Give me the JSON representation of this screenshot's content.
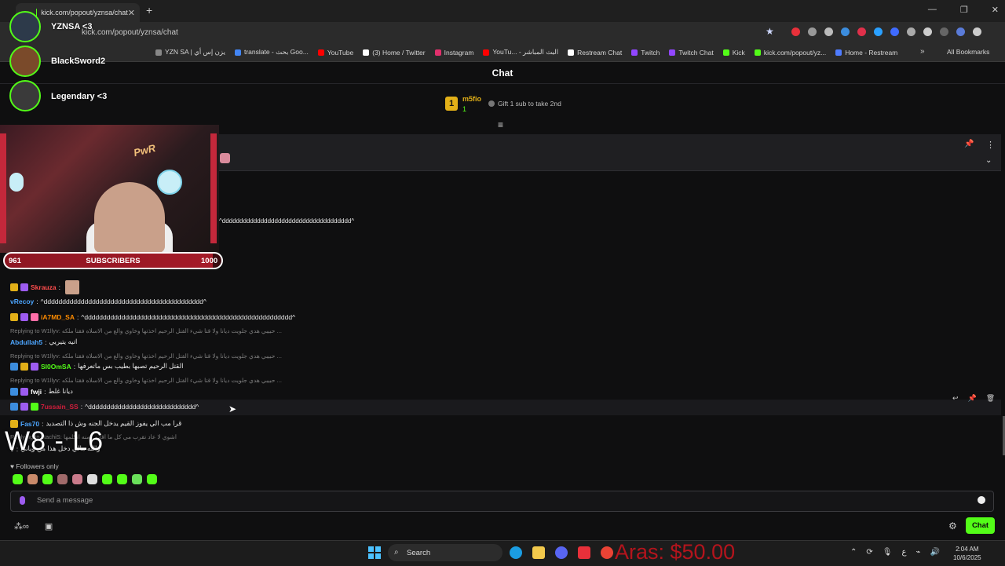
{
  "browser": {
    "tab_title": "kick.com/popout/yznsa/chat",
    "url": "kick.com/popout/yznsa/chat",
    "bookmarks": [
      {
        "label": "YZN SA | يزن إس أي",
        "color": "#888888"
      },
      {
        "label": "translate - بحث Goo...",
        "color": "#4285f4"
      },
      {
        "label": "YouTube",
        "color": "#ff0000"
      },
      {
        "label": "(3) Home / Twitter",
        "color": "#ffffff"
      },
      {
        "label": "Instagram",
        "color": "#e1306c"
      },
      {
        "label": "YouTu... - البث المباشر",
        "color": "#ff0000"
      },
      {
        "label": "Restream Chat",
        "color": "#ffffff"
      },
      {
        "label": "Twitch",
        "color": "#9146ff"
      },
      {
        "label": "Twitch Chat",
        "color": "#9146ff"
      },
      {
        "label": "Kick",
        "color": "#53fc18"
      },
      {
        "label": "kick.com/popout/yz...",
        "color": "#53fc18"
      },
      {
        "label": "Home - Restream",
        "color": "#4f7cff"
      }
    ],
    "all_bookmarks": "All Bookmarks"
  },
  "chat": {
    "title": "Chat",
    "gifter": {
      "rank": "1",
      "name": "m5fio",
      "count": "1",
      "cta": "Gift 1 sub to take 2nd"
    },
    "first_line": "^ddddddddddddddddddddddddddddddddddddd^",
    "messages": [
      {
        "user": "Skrauza",
        "color": "#ff4d4d",
        "text": ""
      },
      {
        "user": "vRecoy",
        "color": "#4da6ff",
        "text": "^ddddddddddddddddddddddddddddddddddddddddddd^"
      },
      {
        "user": "iA7MD_SA",
        "color": "#ff8c00",
        "text": "^dddddddddddddddddddddddddddddddddddddddddddddddddddddddd^"
      },
      {
        "reply": "Replying to W1llyv: حبيبي هدي جلويت ديانا ولا قتا شيء القتل الرحيم اخذتها وخاوي والع من الاسلاه فقتا ملكه ..."
      },
      {
        "user": "Abdullah5",
        "color": "#4da6ff",
        "text": "اتيه يتيريي"
      },
      {
        "reply": "Replying to W1llyv: حبيبي هدي جلويت ديانا ولا قتا شيء القتل الرحيم اخذتها وخاوي والع من الاسلاه فقتا ملكه ..."
      },
      {
        "user": "SI0OmSA",
        "color": "#53fc18",
        "text": "القتل الرحيم تصبها بطيب بس ماتعرفها"
      },
      {
        "reply": "Replying to W1llyv: حبيبي هدي جلويت ديانا ولا قتا شيء القتل الرحيم اخذتها وخاوي والع من الاسلاه فقتا ملكه ..."
      },
      {
        "user": "fwji",
        "color": "#ffffff",
        "text": "ديانا غلط"
      },
      {
        "user": "7ussain_SS",
        "color": "#d21e3c",
        "text": "^ddddddddddddddddddddddddddddd^"
      },
      {
        "user": "Fas70",
        "color": "#4da6ff",
        "text": "قرا مب الي يفوز القيم يدخل الجنه وش ذا التصديد"
      },
      {
        "reply": "Replying to litachiS: اشوي لا عاد تقرب مي كل ما اقارب منه اتكلمها"
      },
      {
        "user": "v",
        "color": "#e6e6e6",
        "text": "والله مالي دخل هذا من وياني"
      }
    ],
    "followers_only": "Followers only",
    "input_placeholder": "Send a message",
    "send_label": "Chat"
  },
  "overlay": {
    "leaderboard": [
      {
        "name": "YZNSA <3"
      },
      {
        "name": "BlackSword2"
      },
      {
        "name": "Legendary <3"
      }
    ],
    "cam_logo": "PwR",
    "sub_goal": {
      "current": "961",
      "label": "SUBSCRIBERS",
      "goal": "1000",
      "progress": 0.961
    },
    "score": "W8 - L6",
    "donation": "Aras: $50.00"
  },
  "taskbar": {
    "search_label": "Search",
    "time": "2:04 AM",
    "date": "10/6/2025",
    "lang": "ع"
  },
  "colors": {
    "accent": "#53fc18",
    "gold": "#e2b018",
    "goal_red": "#a51b28"
  }
}
